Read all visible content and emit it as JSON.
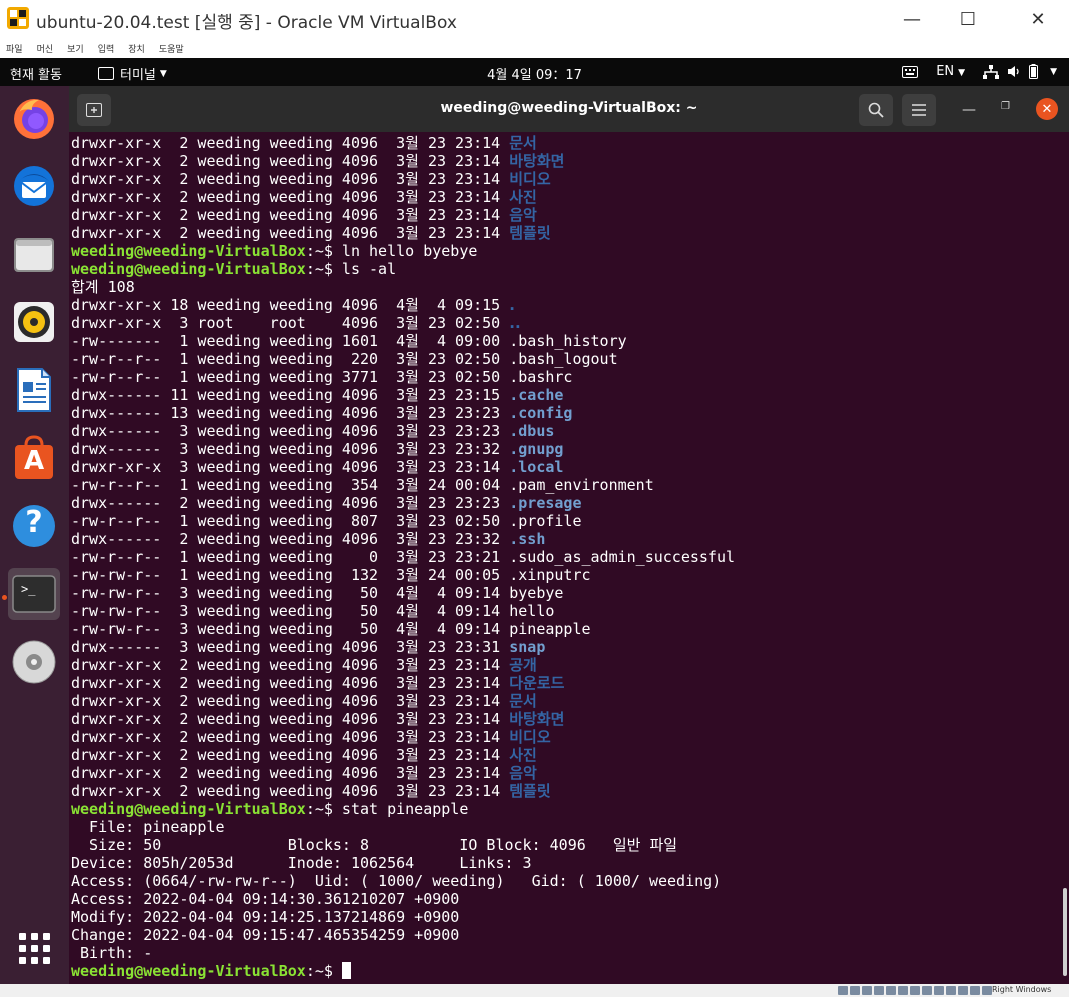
{
  "window": {
    "title": "ubuntu-20.04.test [실행 중] - Oracle VM VirtualBox",
    "minimize_glyph": "—",
    "maximize_glyph": "☐",
    "close_glyph": "✕"
  },
  "vb_menu": [
    "파일",
    "머신",
    "보기",
    "입력",
    "장치",
    "도움말"
  ],
  "topbar": {
    "activities": "현재 활동",
    "app_name": "터미널",
    "clock": "4월 4일  09：17",
    "language": "EN"
  },
  "dock": {
    "items": [
      "firefox",
      "thunderbird",
      "files",
      "rhythmbox",
      "libreoffice-writer",
      "ubuntu-software",
      "help",
      "terminal",
      "dvd"
    ],
    "help_glyph": "?",
    "software_glyph": "A",
    "terminal_glyph": ">_"
  },
  "terminal": {
    "title": "weeding@weeding-VirtualBox: ~",
    "user_host": "weeding@weeding-VirtualBox",
    "prompt_suffix": ":~$",
    "lines": [
      {
        "text": "drwxr-xr-x  2 weeding weeding 4096  3월 23 23:14 ",
        "name": "문서",
        "type": "dir"
      },
      {
        "text": "drwxr-xr-x  2 weeding weeding 4096  3월 23 23:14 ",
        "name": "바탕화면",
        "type": "dir"
      },
      {
        "text": "drwxr-xr-x  2 weeding weeding 4096  3월 23 23:14 ",
        "name": "비디오",
        "type": "dir"
      },
      {
        "text": "drwxr-xr-x  2 weeding weeding 4096  3월 23 23:14 ",
        "name": "사진",
        "type": "dir"
      },
      {
        "text": "drwxr-xr-x  2 weeding weeding 4096  3월 23 23:14 ",
        "name": "음악",
        "type": "dir"
      },
      {
        "text": "drwxr-xr-x  2 weeding weeding 4096  3월 23 23:14 ",
        "name": "템플릿",
        "type": "dir"
      },
      {
        "type": "prompt",
        "command": " ln hello byebye"
      },
      {
        "type": "prompt",
        "command": " ls -al"
      },
      {
        "type": "plain",
        "text": "합계 108"
      },
      {
        "text": "drwxr-xr-x 18 weeding weeding 4096  4월  4 09:15 ",
        "name": ".",
        "type": "dir"
      },
      {
        "text": "drwxr-xr-x  3 root    root    4096  3월 23 02:50 ",
        "name": "..",
        "type": "dir"
      },
      {
        "text": "-rw-------  1 weeding weeding 1601  4월  4 09:00 ",
        "name": ".bash_history",
        "type": "file"
      },
      {
        "text": "-rw-r--r--  1 weeding weeding  220  3월 23 02:50 ",
        "name": ".bash_logout",
        "type": "file"
      },
      {
        "text": "-rw-r--r--  1 weeding weeding 3771  3월 23 02:50 ",
        "name": ".bashrc",
        "type": "file"
      },
      {
        "text": "drwx------ 11 weeding weeding 4096  3월 23 23:15 ",
        "name": ".cache",
        "type": "dirp"
      },
      {
        "text": "drwx------ 13 weeding weeding 4096  3월 23 23:23 ",
        "name": ".config",
        "type": "dirp"
      },
      {
        "text": "drwx------  3 weeding weeding 4096  3월 23 23:23 ",
        "name": ".dbus",
        "type": "dirp"
      },
      {
        "text": "drwx------  3 weeding weeding 4096  3월 23 23:32 ",
        "name": ".gnupg",
        "type": "dirp"
      },
      {
        "text": "drwxr-xr-x  3 weeding weeding 4096  3월 23 23:14 ",
        "name": ".local",
        "type": "dirp"
      },
      {
        "text": "-rw-r--r--  1 weeding weeding  354  3월 24 00:04 ",
        "name": ".pam_environment",
        "type": "file"
      },
      {
        "text": "drwx------  2 weeding weeding 4096  3월 23 23:23 ",
        "name": ".presage",
        "type": "dirp"
      },
      {
        "text": "-rw-r--r--  1 weeding weeding  807  3월 23 02:50 ",
        "name": ".profile",
        "type": "file"
      },
      {
        "text": "drwx------  2 weeding weeding 4096  3월 23 23:32 ",
        "name": ".ssh",
        "type": "dirp"
      },
      {
        "text": "-rw-r--r--  1 weeding weeding    0  3월 23 23:21 ",
        "name": ".sudo_as_admin_successful",
        "type": "file"
      },
      {
        "text": "-rw-rw-r--  1 weeding weeding  132  3월 24 00:05 ",
        "name": ".xinputrc",
        "type": "file"
      },
      {
        "text": "-rw-rw-r--  3 weeding weeding   50  4월  4 09:14 ",
        "name": "byebye",
        "type": "file"
      },
      {
        "text": "-rw-rw-r--  3 weeding weeding   50  4월  4 09:14 ",
        "name": "hello",
        "type": "file"
      },
      {
        "text": "-rw-rw-r--  3 weeding weeding   50  4월  4 09:14 ",
        "name": "pineapple",
        "type": "file"
      },
      {
        "text": "drwx------  3 weeding weeding 4096  3월 23 23:31 ",
        "name": "snap",
        "type": "dirp"
      },
      {
        "text": "drwxr-xr-x  2 weeding weeding 4096  3월 23 23:14 ",
        "name": "공개",
        "type": "dir"
      },
      {
        "text": "drwxr-xr-x  2 weeding weeding 4096  3월 23 23:14 ",
        "name": "다운로드",
        "type": "dir"
      },
      {
        "text": "drwxr-xr-x  2 weeding weeding 4096  3월 23 23:14 ",
        "name": "문서",
        "type": "dir"
      },
      {
        "text": "drwxr-xr-x  2 weeding weeding 4096  3월 23 23:14 ",
        "name": "바탕화면",
        "type": "dir"
      },
      {
        "text": "drwxr-xr-x  2 weeding weeding 4096  3월 23 23:14 ",
        "name": "비디오",
        "type": "dir"
      },
      {
        "text": "drwxr-xr-x  2 weeding weeding 4096  3월 23 23:14 ",
        "name": "사진",
        "type": "dir"
      },
      {
        "text": "drwxr-xr-x  2 weeding weeding 4096  3월 23 23:14 ",
        "name": "음악",
        "type": "dir"
      },
      {
        "text": "drwxr-xr-x  2 weeding weeding 4096  3월 23 23:14 ",
        "name": "템플릿",
        "type": "dir"
      },
      {
        "type": "prompt",
        "command": " stat pineapple"
      },
      {
        "type": "plain",
        "text": "  File: pineapple"
      },
      {
        "type": "plain",
        "text": "  Size: 50              Blocks: 8          IO Block: 4096   일반 파일"
      },
      {
        "type": "plain",
        "text": "Device: 805h/2053d      Inode: 1062564     Links: 3"
      },
      {
        "type": "plain",
        "text": "Access: (0664/-rw-rw-r--)  Uid: ( 1000/ weeding)   Gid: ( 1000/ weeding)"
      },
      {
        "type": "plain",
        "text": "Access: 2022-04-04 09:14:30.361210207 +0900"
      },
      {
        "type": "plain",
        "text": "Modify: 2022-04-04 09:14:25.137214869 +0900"
      },
      {
        "type": "plain",
        "text": "Change: 2022-04-04 09:15:47.465354259 +0900"
      },
      {
        "type": "plain",
        "text": " Birth: -"
      },
      {
        "type": "prompt",
        "command": " ",
        "cursor": true
      }
    ]
  },
  "vb_status": {
    "hostkey": "Right Windows"
  },
  "colors": {
    "terminal_bg": "#300a24",
    "prompt_green": "#8ae234",
    "dir_blue": "#3465a4",
    "dir_light_blue": "#729fcf",
    "accent_orange": "#e95420",
    "dock_bg": "#3a1f33",
    "header_bg": "#2c2c2c"
  }
}
